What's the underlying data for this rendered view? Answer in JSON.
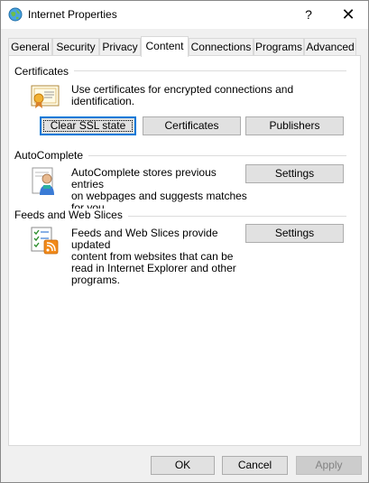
{
  "window": {
    "title": "Internet Properties",
    "help_glyph": "?",
    "close_glyph": "✕"
  },
  "tabs": [
    {
      "label": "General"
    },
    {
      "label": "Security"
    },
    {
      "label": "Privacy"
    },
    {
      "label": "Content",
      "active": true
    },
    {
      "label": "Connections"
    },
    {
      "label": "Programs"
    },
    {
      "label": "Advanced"
    }
  ],
  "certificates": {
    "title": "Certificates",
    "description": "Use certificates for encrypted connections and identification.",
    "clear_ssl_label": "Clear SSL state",
    "certificates_label": "Certificates",
    "publishers_label": "Publishers",
    "icon": "certificate-icon"
  },
  "autocomplete": {
    "title": "AutoComplete",
    "description_lines": [
      "AutoComplete stores previous entries",
      "on webpages and suggests matches",
      "for you."
    ],
    "settings_label": "Settings",
    "icon": "autocomplete-user-icon"
  },
  "feeds": {
    "title": "Feeds and Web Slices",
    "description_lines": [
      "Feeds and Web Slices provide updated",
      "content from websites that can be",
      "read in Internet Explorer and other",
      "programs."
    ],
    "settings_label": "Settings",
    "icon": "feeds-rss-icon"
  },
  "footer": {
    "ok_label": "OK",
    "cancel_label": "Cancel",
    "apply_label": "Apply"
  }
}
